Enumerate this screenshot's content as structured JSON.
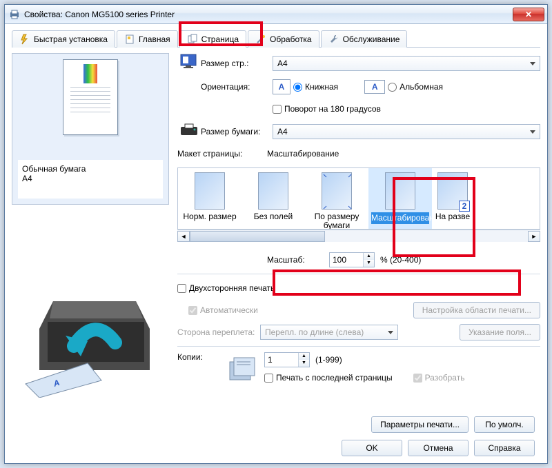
{
  "window": {
    "title": "Свойства: Canon MG5100 series Printer"
  },
  "tabs": {
    "quick": "Быстрая установка",
    "main": "Главная",
    "page": "Страница",
    "effects": "Обработка",
    "service": "Обслуживание"
  },
  "preview": {
    "paper_type": "Обычная бумага",
    "paper_size": "A4"
  },
  "labels": {
    "page_size": "Размер стр.:",
    "orientation": "Ориентация:",
    "portrait": "Книжная",
    "landscape": "Альбомная",
    "rotate180": "Поворот на 180 градусов",
    "paper_size": "Размер бумаги:",
    "layout": "Макет страницы:",
    "layout_value": "Масштабирование",
    "normal": "Норм. размер",
    "borderless": "Без полей",
    "fit": "По размеру бумаги",
    "scaled": "Масштабирование",
    "poster": "На разве",
    "poster_badge": "2",
    "scale": "Масштаб:",
    "scale_range": "% (20-400)",
    "duplex": "Двухсторонняя печать",
    "auto": "Автоматически",
    "area_setup": "Настройка области печати...",
    "staple_side": "Сторона переплета:",
    "staple_value": "Перепл. по длине (слева)",
    "margin": "Указание поля...",
    "copies": "Копии:",
    "copies_range": "(1-999)",
    "from_last": "Печать с последней страницы",
    "collate": "Разобрать"
  },
  "values": {
    "page_size": "A4",
    "paper_size": "A4",
    "scale": "100",
    "copies": "1",
    "orientation_portrait": true,
    "rotate180": false,
    "duplex": false,
    "auto": true,
    "from_last": false,
    "collate": true
  },
  "buttons": {
    "print_params": "Параметры печати...",
    "defaults": "По умолч.",
    "ok": "OK",
    "cancel": "Отмена",
    "help": "Справка"
  }
}
